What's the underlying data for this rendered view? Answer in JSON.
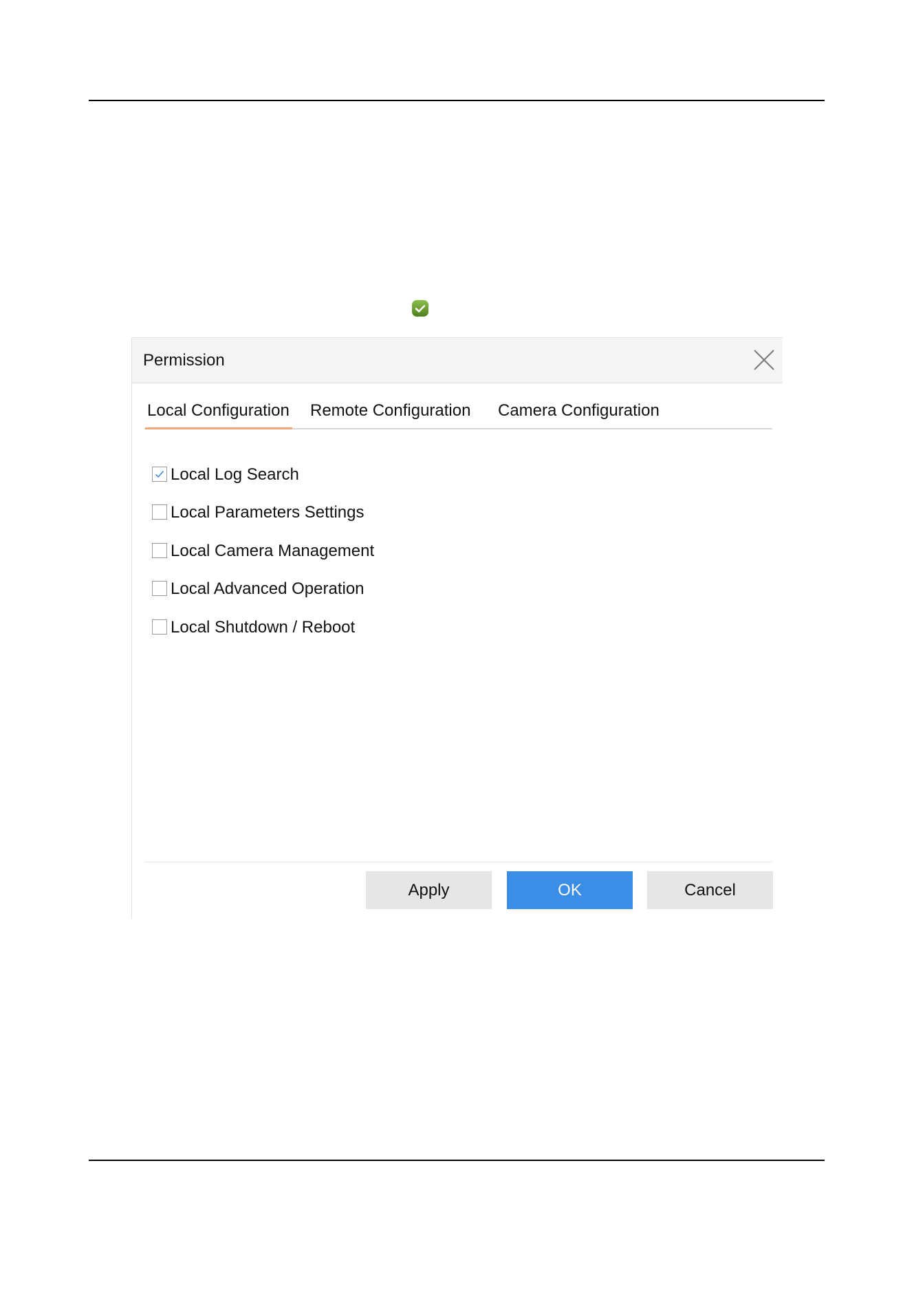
{
  "dialog": {
    "title": "Permission",
    "close_icon": "close-icon"
  },
  "tabs": [
    {
      "label": "Local Configuration",
      "active": true
    },
    {
      "label": "Remote Configuration",
      "active": false
    },
    {
      "label": "Camera Configuration",
      "active": false
    }
  ],
  "options": [
    {
      "label": "Local Log Search",
      "checked": true
    },
    {
      "label": "Local Parameters Settings",
      "checked": false
    },
    {
      "label": "Local Camera Management",
      "checked": false
    },
    {
      "label": "Local Advanced Operation",
      "checked": false
    },
    {
      "label": "Local Shutdown / Reboot",
      "checked": false
    }
  ],
  "buttons": {
    "apply": "Apply",
    "ok": "OK",
    "cancel": "Cancel"
  },
  "icons": {
    "status": "check-circle-icon"
  },
  "colors": {
    "primary_button": "#3a8ee6",
    "active_tab_underline": "#f0a77a",
    "check_mark": "#3a8ee6",
    "status_icon": "#6a9a2c"
  }
}
